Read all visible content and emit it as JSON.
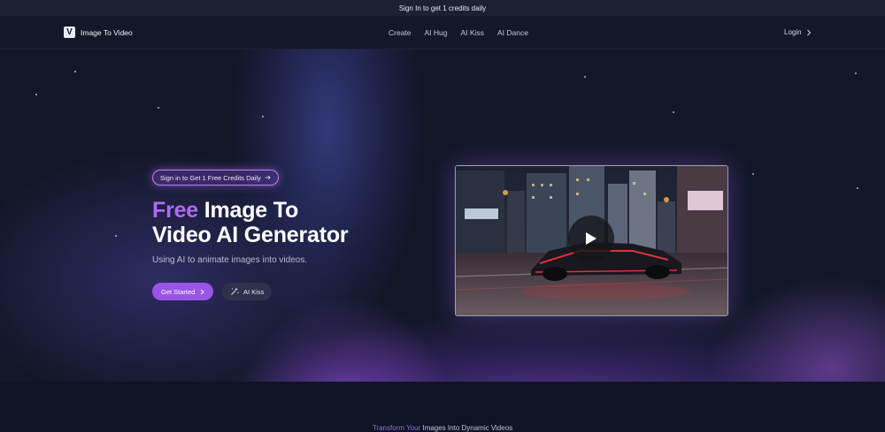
{
  "top_banner": {
    "text": "Sign In to get 1 credits daily"
  },
  "navbar": {
    "brand_logo_letter": "V",
    "brand_name": "Image To Video",
    "links": [
      "Create",
      "AI Hug",
      "AI Kiss",
      "AI Dance"
    ],
    "login_label": "Login"
  },
  "hero": {
    "pill_label": "Sign in to Get 1 Free Credits Daily",
    "title_accent": "Free",
    "title_line1_rest": " Image To",
    "title_line2": "Video AI Generator",
    "subtitle": "Using AI to animate images into videos.",
    "cta_primary_label": "Get Started",
    "cta_secondary_label": "AI Kiss"
  },
  "video": {
    "play_icon": "play-icon"
  },
  "section": {
    "heading_part1": "Transform Your",
    "heading_part2": " Images Into Dynamic Videos"
  },
  "colors": {
    "accent": "#b06af5",
    "button_primary": "#9a55e6",
    "background": "#0f1424"
  }
}
